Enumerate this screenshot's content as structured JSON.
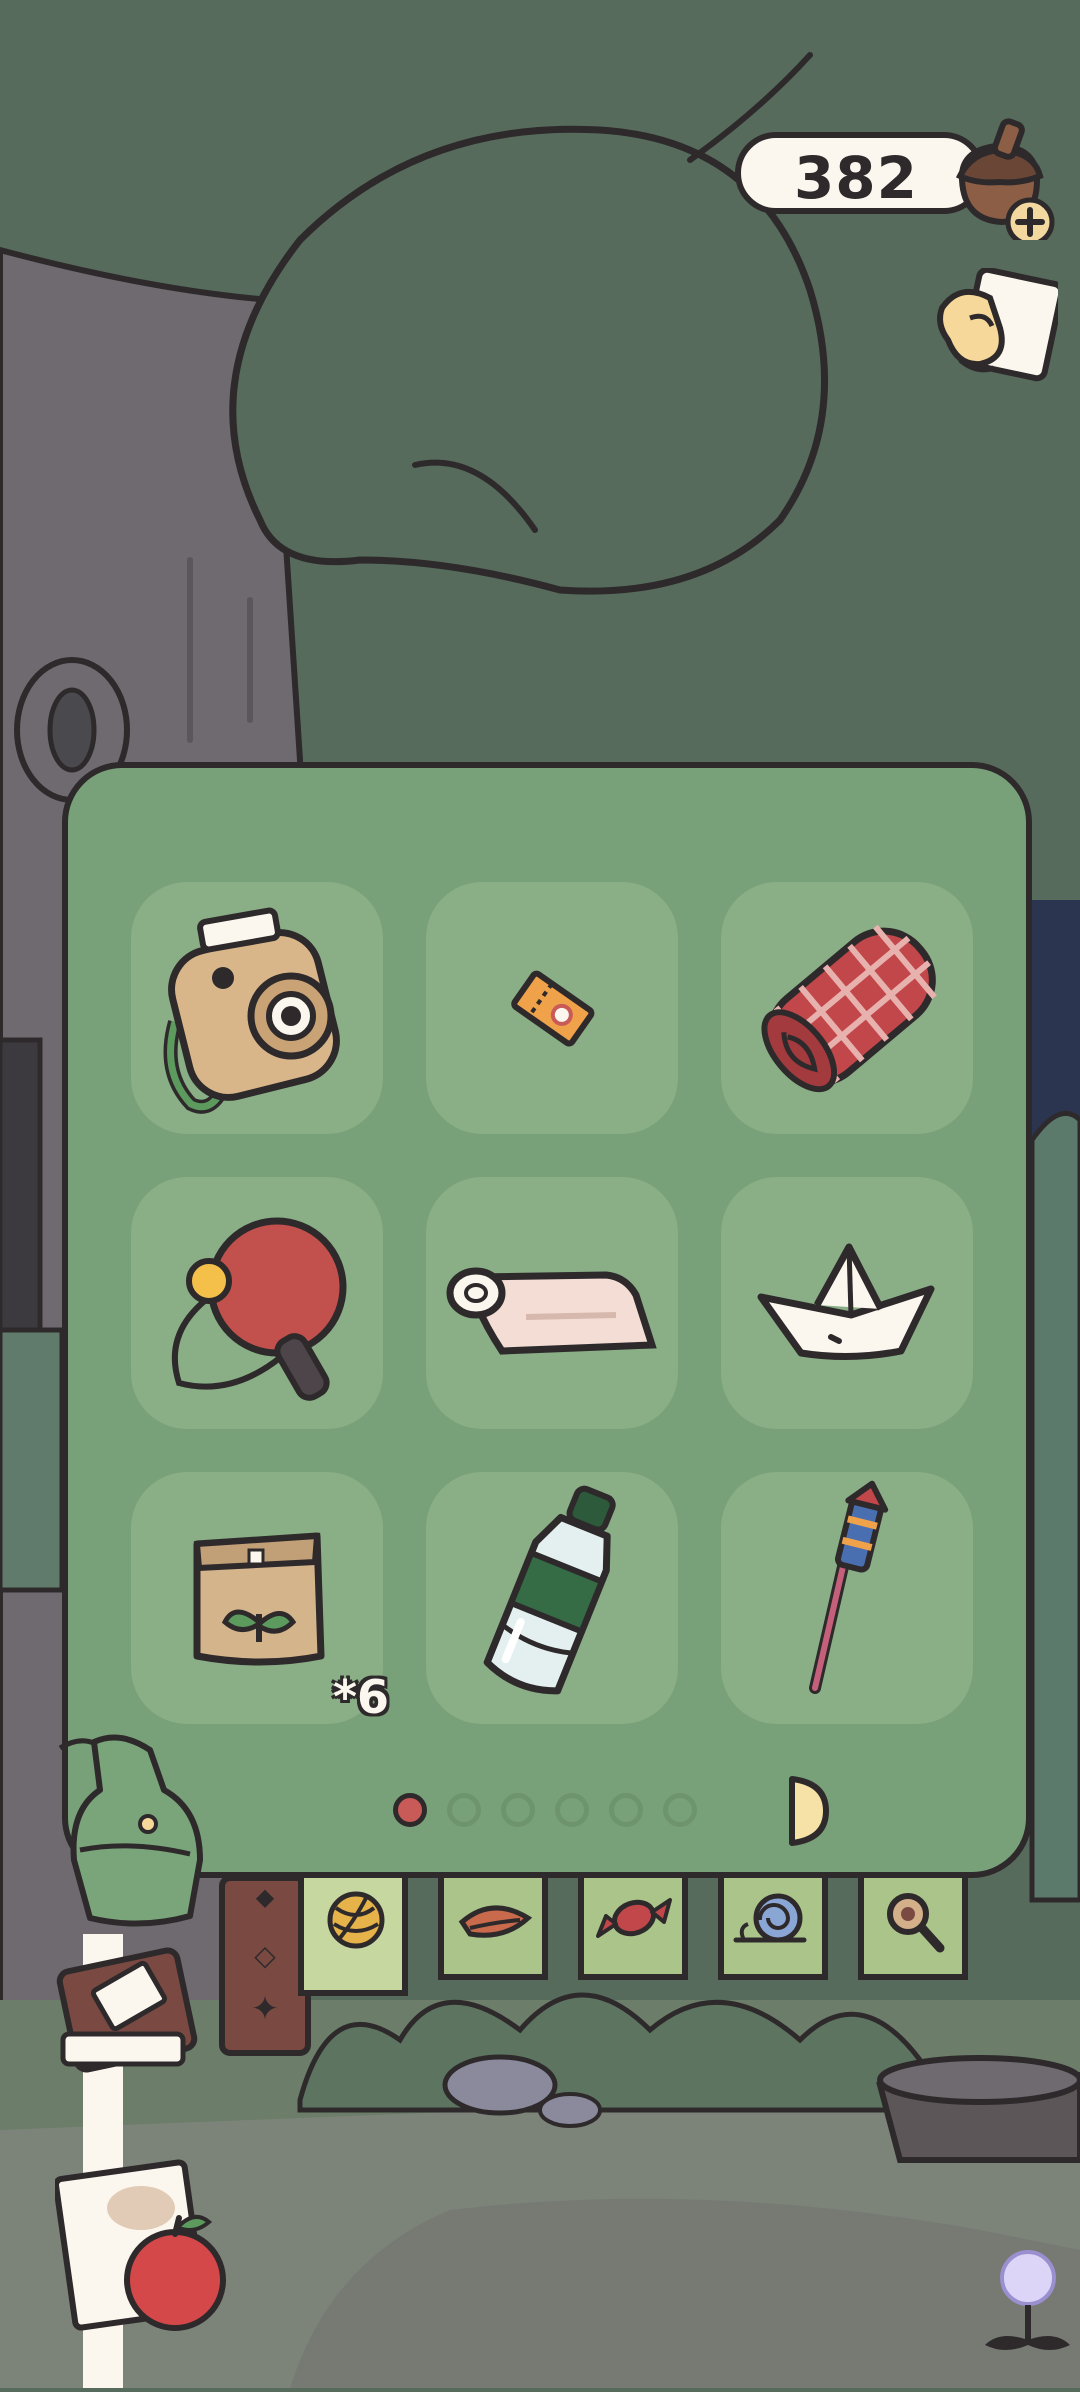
{
  "currency": {
    "amount": "382"
  },
  "icons": {
    "currency": "acorn-plus-icon",
    "mail": "letter-hand-icon",
    "next_page": "arrow-right-icon"
  },
  "inventory": {
    "items": [
      {
        "name": "instant-camera",
        "quantity": ""
      },
      {
        "name": "ticket",
        "quantity": ""
      },
      {
        "name": "rolled-plaid-blanket",
        "quantity": ""
      },
      {
        "name": "ping-pong-paddle",
        "quantity": ""
      },
      {
        "name": "rolled-mat",
        "quantity": ""
      },
      {
        "name": "paper-boat",
        "quantity": ""
      },
      {
        "name": "seed-bag",
        "quantity": "*6"
      },
      {
        "name": "water-bottle",
        "quantity": ""
      },
      {
        "name": "firework-rocket",
        "quantity": ""
      }
    ],
    "page": 1,
    "page_count": 6
  },
  "tabs": [
    {
      "name": "yarn-tab"
    },
    {
      "name": "leaf-food-tab"
    },
    {
      "name": "candy-tab"
    },
    {
      "name": "snail-tab"
    },
    {
      "name": "magnifier-tab"
    }
  ],
  "colors": {
    "panel": "#79a179",
    "slot": "#8aae86",
    "outline": "#2e2a2c",
    "active_dot": "#c85a58",
    "background": "#566b5c"
  }
}
